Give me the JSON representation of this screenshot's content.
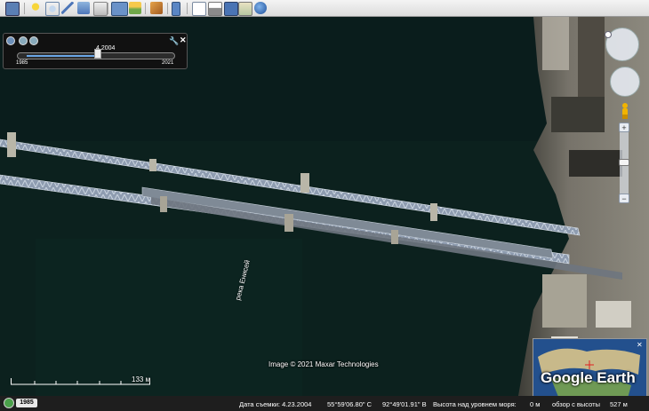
{
  "time_slider": {
    "current_date": "4.2004",
    "start_year": "1985",
    "end_year": "2021"
  },
  "map": {
    "river_label": "река Енисей",
    "copyright": "Image © 2021 Maxar Technologies",
    "scale_label": "133 м"
  },
  "overview": {
    "logo": "Google Earth"
  },
  "status_bar": {
    "year": "1985",
    "capture_date": "Дата съемки: 4.23.2004",
    "latitude": "55°59'06.80\" С",
    "longitude": "92°49'01.91\" В",
    "elevation": "Высота над уровнем моря:",
    "elevation_value": "0 м",
    "eye_alt": "обзор с высоты",
    "eye_alt_value": "527 м"
  },
  "colors": {
    "water": "#0b1f1c",
    "bridge": "#9aa8b8",
    "shore": "#6d6a62",
    "toolbar": "#dcdcdc"
  },
  "icons": [
    "sidebar-icon",
    "placemark-icon",
    "polygon-icon",
    "path-icon",
    "overlay-icon",
    "tour-icon",
    "historical-imagery-icon",
    "sun-icon",
    "planets-icon",
    "ruler-icon",
    "email-icon",
    "print-icon",
    "save-image-icon",
    "maps-icon",
    "earth-gallery-icon"
  ]
}
